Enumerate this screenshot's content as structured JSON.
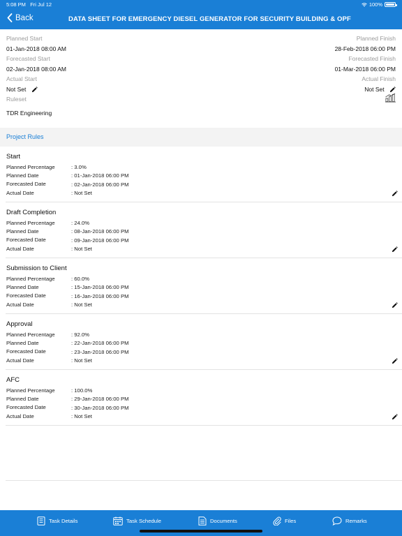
{
  "status_bar": {
    "time": "5:08 PM",
    "date": "Fri Jul 12",
    "battery": "100%"
  },
  "nav": {
    "back_label": "Back",
    "title": "DATA SHEET FOR EMERGENCY DIESEL GENERATOR FOR SECURITY BUILDING & OPF"
  },
  "info": {
    "planned_start_label": "Planned Start",
    "planned_start": "01-Jan-2018 08:00 AM",
    "planned_finish_label": "Planned Finish",
    "planned_finish": "28-Feb-2018 06:00 PM",
    "forecasted_start_label": "Forecasted Start",
    "forecasted_start": "02-Jan-2018 08:00 AM",
    "forecasted_finish_label": "Forecasted Finish",
    "forecasted_finish": "01-Mar-2018 06:00 PM",
    "actual_start_label": "Actual Start",
    "actual_start": "Not Set",
    "actual_finish_label": "Actual Finish",
    "actual_finish": "Not Set",
    "ruleset_label": "Ruleset",
    "ruleset": "TDR Engineering"
  },
  "project_rules_label": "Project Rules",
  "field_labels": {
    "planned_percentage": "Planned Percentage",
    "planned_date": "Planned Date",
    "forecasted_date": "Forecasted Date",
    "actual_date": "Actual Date"
  },
  "rules": [
    {
      "title": "Start",
      "planned_percentage": ": 3.0%",
      "planned_date": ": 01-Jan-2018 06:00 PM",
      "forecasted_date": ": 02-Jan-2018 06:00 PM",
      "actual_date": ": Not Set"
    },
    {
      "title": "Draft Completion",
      "planned_percentage": ": 24.0%",
      "planned_date": ": 08-Jan-2018 06:00 PM",
      "forecasted_date": ": 09-Jan-2018 06:00 PM",
      "actual_date": ": Not Set"
    },
    {
      "title": "Submission to Client",
      "planned_percentage": ": 60.0%",
      "planned_date": ": 15-Jan-2018 06:00 PM",
      "forecasted_date": ": 16-Jan-2018 06:00 PM",
      "actual_date": ": Not Set"
    },
    {
      "title": "Approval",
      "planned_percentage": ": 92.0%",
      "planned_date": ": 22-Jan-2018 06:00 PM",
      "forecasted_date": ": 23-Jan-2018 06:00 PM",
      "actual_date": ": Not Set"
    },
    {
      "title": "AFC",
      "planned_percentage": ": 100.0%",
      "planned_date": ": 29-Jan-2018 06:00 PM",
      "forecasted_date": ": 30-Jan-2018 06:00 PM",
      "actual_date": ": Not Set"
    }
  ],
  "tabs": [
    {
      "label": "Task Details",
      "icon": "task-details-icon"
    },
    {
      "label": "Task Schedule",
      "icon": "calendar-icon"
    },
    {
      "label": "Documents",
      "icon": "documents-icon"
    },
    {
      "label": "Files",
      "icon": "paperclip-icon"
    },
    {
      "label": "Remarks",
      "icon": "chat-bubble-icon"
    }
  ],
  "colors": {
    "primary": "#1a7fd6",
    "label_gray": "#9a9a9a",
    "section_bg": "#f3f3f3"
  }
}
